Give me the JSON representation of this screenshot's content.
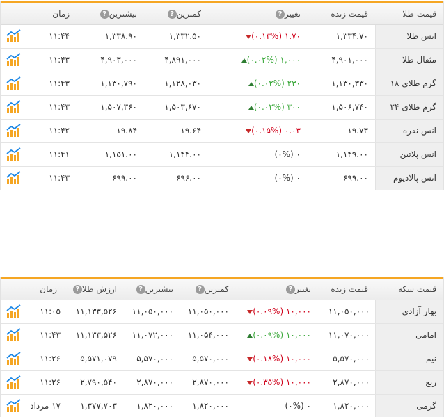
{
  "colors": {
    "accent": "#f5a623",
    "up": "#3aa83a",
    "down": "#d0021b"
  },
  "gold": {
    "headers": {
      "name": "قیمت طلا",
      "live": "قیمت زنده",
      "change": "تغییر",
      "min": "کمترین",
      "max": "بیشترین",
      "time": "زمان"
    },
    "rows": [
      {
        "name": "انس طلا",
        "live": "۱,۳۳۴.۷۰",
        "dir": "down",
        "change": "۱.۷۰ (۰.۱۳%)",
        "min": "۱,۳۳۲.۵۰",
        "max": "۱,۳۳۸.۹۰",
        "time": "۱۱:۴۴"
      },
      {
        "name": "مثقال طلا",
        "live": "۴,۹۰۱,۰۰۰",
        "dir": "up",
        "change": "۱,۰۰۰ (۰.۰۲%)",
        "min": "۴,۸۹۱,۰۰۰",
        "max": "۴,۹۰۳,۰۰۰",
        "time": "۱۱:۴۳"
      },
      {
        "name": "گرم طلای ۱۸",
        "live": "۱,۱۳۰,۳۳۰",
        "dir": "up",
        "change": "۲۳۰ (۰.۰۲%)",
        "min": "۱,۱۲۸,۰۳۰",
        "max": "۱,۱۳۰,۷۹۰",
        "time": "۱۱:۴۳"
      },
      {
        "name": "گرم طلای ۲۴",
        "live": "۱,۵۰۶,۷۴۰",
        "dir": "up",
        "change": "۳۰۰ (۰.۰۲%)",
        "min": "۱,۵۰۳,۶۷۰",
        "max": "۱,۵۰۷,۳۶۰",
        "time": "۱۱:۴۳"
      },
      {
        "name": "انس نقره",
        "live": "۱۹.۷۳",
        "dir": "down",
        "change": "۰.۰۳ (۰.۱۵%)",
        "min": "۱۹.۶۴",
        "max": "۱۹.۸۴",
        "time": "۱۱:۴۲"
      },
      {
        "name": "انس پلاتین",
        "live": "۱,۱۴۹.۰۰",
        "dir": "neutral",
        "change": "۰ (۰%)",
        "min": "۱,۱۴۴.۰۰",
        "max": "۱,۱۵۱.۰۰",
        "time": "۱۱:۴۱"
      },
      {
        "name": "انس پالادیوم",
        "live": "۶۹۹.۰۰",
        "dir": "neutral",
        "change": "۰ (۰%)",
        "min": "۶۹۶.۰۰",
        "max": "۶۹۹.۰۰",
        "time": "۱۱:۴۳"
      }
    ]
  },
  "coin": {
    "headers": {
      "name": "قیمت سکه",
      "live": "قیمت زنده",
      "change": "تغییر",
      "min": "کمترین",
      "max": "بیشترین",
      "goldvalue": "ارزش طلا",
      "time": "زمان"
    },
    "rows": [
      {
        "name": "بهار آزادی",
        "live": "۱۱,۰۵۰,۰۰۰",
        "dir": "down",
        "change": "۱۰,۰۰۰ (۰.۰۹%)",
        "min": "۱۱,۰۵۰,۰۰۰",
        "max": "۱۱,۰۵۰,۰۰۰",
        "goldvalue": "۱۱,۱۳۳,۵۲۶",
        "time": "۱۱:۰۵"
      },
      {
        "name": "امامی",
        "live": "۱۱,۰۷۰,۰۰۰",
        "dir": "up",
        "change": "۱۰,۰۰۰ (۰.۰۹%)",
        "min": "۱۱,۰۵۴,۰۰۰",
        "max": "۱۱,۰۷۲,۰۰۰",
        "goldvalue": "۱۱,۱۳۳,۵۲۶",
        "time": "۱۱:۴۳"
      },
      {
        "name": "نیم",
        "live": "۵,۵۷۰,۰۰۰",
        "dir": "down",
        "change": "۱۰,۰۰۰ (۰.۱۸%)",
        "min": "۵,۵۷۰,۰۰۰",
        "max": "۵,۵۷۰,۰۰۰",
        "goldvalue": "۵,۵۷۱,۰۷۹",
        "time": "۱۱:۲۶"
      },
      {
        "name": "ربع",
        "live": "۲,۸۷۰,۰۰۰",
        "dir": "down",
        "change": "۱۰,۰۰۰ (۰.۳۵%)",
        "min": "۲,۸۷۰,۰۰۰",
        "max": "۲,۸۷۰,۰۰۰",
        "goldvalue": "۲,۷۹۰,۵۴۰",
        "time": "۱۱:۲۶"
      },
      {
        "name": "گرمی",
        "live": "۱,۸۲۰,۰۰۰",
        "dir": "neutral",
        "change": "۰ (۰%)",
        "min": "۱,۸۲۰,۰۰۰",
        "max": "۱,۸۲۰,۰۰۰",
        "goldvalue": "۱,۳۷۷,۷۰۳",
        "time": "۱۷ مرداد"
      }
    ]
  }
}
